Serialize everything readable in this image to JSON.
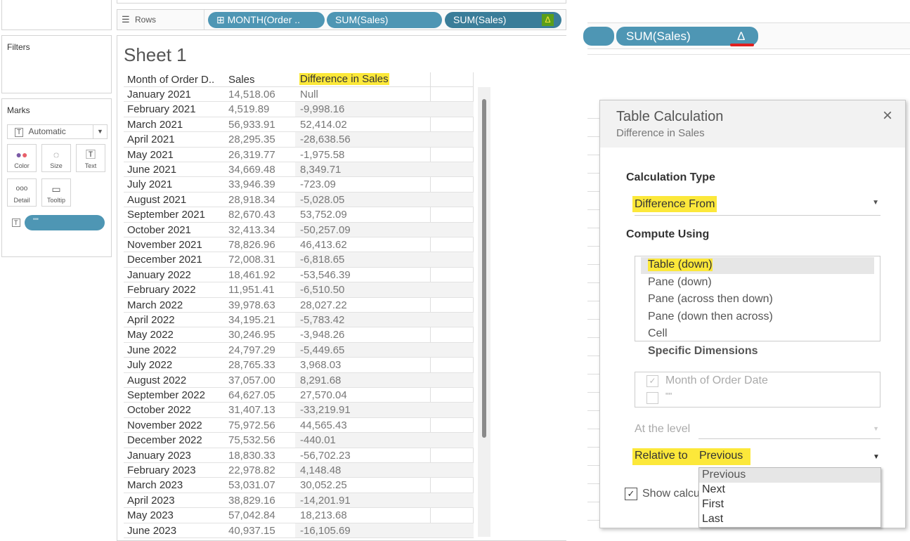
{
  "shelf": {
    "rows_label": "Rows",
    "pills": [
      "MONTH(Order ..",
      "SUM(Sales)",
      "SUM(Sales)"
    ],
    "delta_symbol": "Δ",
    "zoom_pill": "SUM(Sales)"
  },
  "filters": {
    "title": "Filters"
  },
  "marks": {
    "title": "Marks",
    "type": "Automatic",
    "cards": [
      "Color",
      "Size",
      "Text",
      "Detail",
      "Tooltip"
    ],
    "text_pill": "\"\""
  },
  "sheet": {
    "title": "Sheet 1",
    "headers": [
      "Month of Order D..",
      "Sales",
      "Difference in Sales"
    ],
    "rows": [
      [
        "January 2021",
        "14,518.06",
        "Null"
      ],
      [
        "February 2021",
        "4,519.89",
        "-9,998.16"
      ],
      [
        "March 2021",
        "56,933.91",
        "52,414.02"
      ],
      [
        "April 2021",
        "28,295.35",
        "-28,638.56"
      ],
      [
        "May 2021",
        "26,319.77",
        "-1,975.58"
      ],
      [
        "June 2021",
        "34,669.48",
        "8,349.71"
      ],
      [
        "July 2021",
        "33,946.39",
        "-723.09"
      ],
      [
        "August 2021",
        "28,918.34",
        "-5,028.05"
      ],
      [
        "September 2021",
        "82,670.43",
        "53,752.09"
      ],
      [
        "October 2021",
        "32,413.34",
        "-50,257.09"
      ],
      [
        "November 2021",
        "78,826.96",
        "46,413.62"
      ],
      [
        "December 2021",
        "72,008.31",
        "-6,818.65"
      ],
      [
        "January 2022",
        "18,461.92",
        "-53,546.39"
      ],
      [
        "February 2022",
        "11,951.41",
        "-6,510.50"
      ],
      [
        "March 2022",
        "39,978.63",
        "28,027.22"
      ],
      [
        "April 2022",
        "34,195.21",
        "-5,783.42"
      ],
      [
        "May 2022",
        "30,246.95",
        "-3,948.26"
      ],
      [
        "June 2022",
        "24,797.29",
        "-5,449.65"
      ],
      [
        "July 2022",
        "28,765.33",
        "3,968.03"
      ],
      [
        "August 2022",
        "37,057.00",
        "8,291.68"
      ],
      [
        "September 2022",
        "64,627.05",
        "27,570.04"
      ],
      [
        "October 2022",
        "31,407.13",
        "-33,219.91"
      ],
      [
        "November 2022",
        "75,972.56",
        "44,565.43"
      ],
      [
        "December 2022",
        "75,532.56",
        "-440.01"
      ],
      [
        "January 2023",
        "18,830.33",
        "-56,702.23"
      ],
      [
        "February 2023",
        "22,978.82",
        "4,148.48"
      ],
      [
        "March 2023",
        "53,031.07",
        "30,052.25"
      ],
      [
        "April 2023",
        "38,829.16",
        "-14,201.91"
      ],
      [
        "May 2023",
        "57,042.84",
        "18,213.68"
      ],
      [
        "June 2023",
        "40,937.15",
        "-16,105.69"
      ]
    ]
  },
  "dialog": {
    "title": "Table Calculation",
    "subtitle": "Difference in Sales",
    "calc_type_label": "Calculation Type",
    "calc_type_value": "Difference From",
    "compute_using_label": "Compute Using",
    "compute_options": [
      "Table (down)",
      "Pane (down)",
      "Pane (across then down)",
      "Pane (down then across)",
      "Cell",
      "Specific Dimensions"
    ],
    "dimensions": [
      {
        "label": "Month of Order Date",
        "checked": true
      },
      {
        "label": "\"\"",
        "checked": false
      }
    ],
    "at_level_label": "At the level",
    "relative_label": "Relative to",
    "relative_value": "Previous",
    "relative_options": [
      "Previous",
      "Next",
      "First",
      "Last"
    ],
    "show_calc_label": "Show calcu"
  },
  "colors": {
    "pill": "#4e96b4",
    "pill_dark": "#3a7d99",
    "highlight": "#fce83a",
    "marker": "#e02020"
  }
}
